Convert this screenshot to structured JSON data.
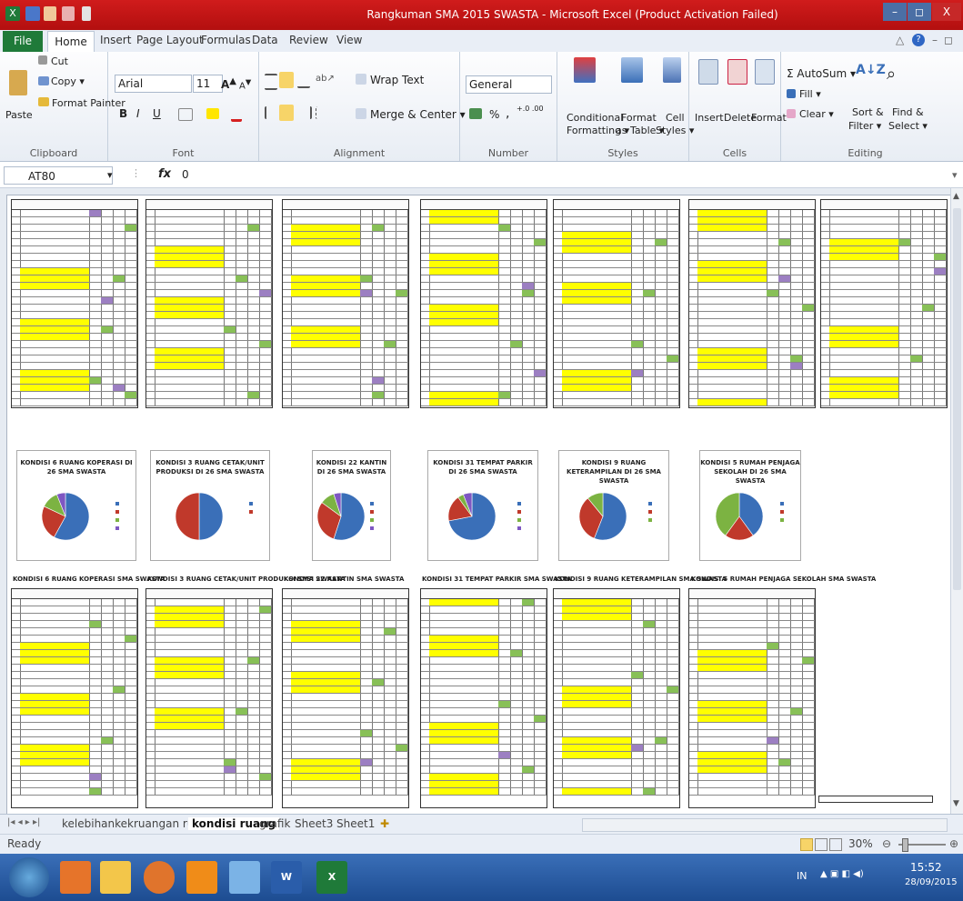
{
  "window": {
    "title": "Rangkuman SMA 2015 SWASTA  -  Microsoft Excel (Product Activation Failed)",
    "minimize": "–",
    "restore": "◻",
    "close": "X"
  },
  "ribbon_tabs": [
    "File",
    "Home",
    "Insert",
    "Page Layout",
    "Formulas",
    "Data",
    "Review",
    "View"
  ],
  "clipboard": {
    "paste": "Paste",
    "cut": "Cut",
    "copy": "Copy ▾",
    "format_painter": "Format Painter",
    "group": "Clipboard"
  },
  "font": {
    "name": "Arial",
    "size": "11",
    "bold": "B",
    "italic": "I",
    "underline": "U",
    "group": "Font"
  },
  "alignment": {
    "wrap": "Wrap Text",
    "merge": "Merge & Center ▾",
    "group": "Alignment"
  },
  "number": {
    "format": "General",
    "percent": "%",
    "comma": ",",
    "inc": "+.0 .00",
    "dec": ".00 →.0",
    "group": "Number"
  },
  "styles": {
    "conditional": "Conditional",
    "conditional2": "Formatting ▾",
    "format_as": "Format",
    "format_as2": "as Table ▾",
    "cell": "Cell",
    "cell2": "Styles ▾",
    "group": "Styles"
  },
  "cells": {
    "insert": "Insert",
    "delete": "Delete",
    "format": "Format",
    "group": "Cells"
  },
  "editing": {
    "autosum": "Σ AutoSum ▾",
    "fill": "Fill ▾",
    "clear": "Clear ▾",
    "sort": "Sort &",
    "sort2": "Filter ▾",
    "find": "Find &",
    "find2": "Select ▾",
    "group": "Editing"
  },
  "formula_bar": {
    "name_box": "AT80",
    "fx": "fx",
    "value": "0"
  },
  "charts": [
    {
      "title": "KONDISI 6 RUANG KOPERASI DI 26 SMA SWASTA"
    },
    {
      "title": "KONDISI 3 RUANG CETAK/UNIT PRODUKSI DI 26 SMA SWASTA"
    },
    {
      "title": "KONDISI 22 KANTIN DI 26 SMA SWASTA"
    },
    {
      "title": "KONDISI 31 TEMPAT PARKIR DI 26 SMA SWASTA"
    },
    {
      "title": "KONDISI 9 RUANG KETERAMPILAN DI 26 SMA SWASTA"
    },
    {
      "title": "KONDISI 5 RUMAH PENJAGA SEKOLAH DI 26 SMA SWASTA"
    }
  ],
  "table_titles": [
    "KONDISI 6 RUANG KOPERASI SMA SWASTA",
    "KONDISI 3 RUANG CETAK/UNIT PRODUKSI SMA SWASTA",
    "KONDISI 22 KANTIN SMA SWASTA",
    "KONDISI 31 TEMPAT PARKIR SMA SWASTA",
    "KONDISI 9 RUANG KETERAMPILAN SMA SWASTA",
    "KONDISI 5 RUMAH PENJAGA SEKOLAH SMA SWASTA"
  ],
  "sheet_tabs": [
    "kelebihankekruangan ruang",
    "kondisi ruang",
    "grafik",
    "Sheet3",
    "Sheet1"
  ],
  "status": {
    "ready": "Ready",
    "zoom": "30%"
  },
  "taskbar": {
    "time": "15:52",
    "date": "28/09/2015",
    "lang": "IN"
  },
  "colors": {
    "title_bar": "#c8161c",
    "file_tab": "#1f7a39",
    "highlight_yellow": "#ffff00",
    "highlight_green": "#88c057",
    "pie_blue": "#3a6fb8",
    "pie_red": "#c0392b",
    "pie_green": "#7cb342",
    "pie_purple": "#7e57c2"
  }
}
